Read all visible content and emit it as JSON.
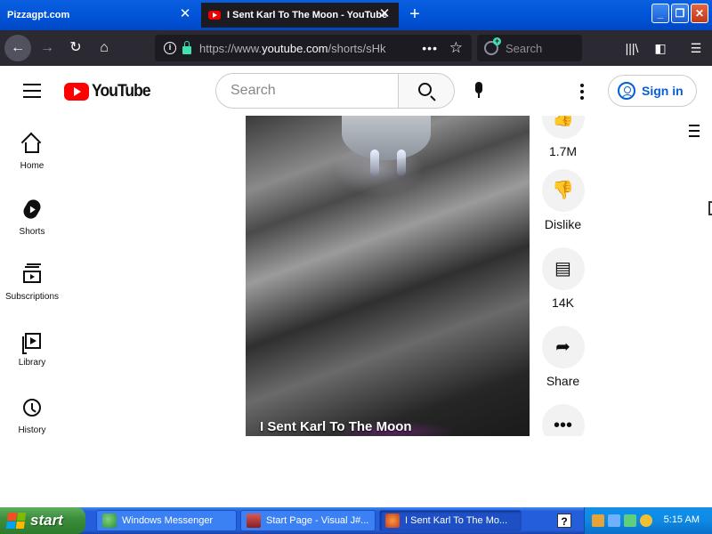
{
  "browser": {
    "tabs": [
      {
        "title": "Pizzagpt.com",
        "active": false
      },
      {
        "title": "I Sent Karl To The Moon - YouTube",
        "active": true
      }
    ],
    "url": {
      "prefix": "https://www.",
      "domain": "youtube.com",
      "rest": "/shorts/sHk"
    },
    "search_placeholder": "Search",
    "accent_color": "#0052d6"
  },
  "youtube": {
    "logo_text": "YouTube",
    "search_placeholder": "Search",
    "signin_label": "Sign in",
    "sidebar": [
      {
        "label": "Home",
        "icon": "home-icon"
      },
      {
        "label": "Shorts",
        "icon": "shorts-icon"
      },
      {
        "label": "Subscriptions",
        "icon": "subscriptions-icon"
      },
      {
        "label": "Library",
        "icon": "library-icon"
      },
      {
        "label": "History",
        "icon": "history-icon"
      }
    ],
    "video": {
      "title": "I Sent Karl To The Moon"
    },
    "actions": {
      "likes": "1.7M",
      "dislike": "Dislike",
      "comments": "14K",
      "share": "Share"
    },
    "brand_color": "#ff0000",
    "link_color": "#065fd4"
  },
  "taskbar": {
    "start_label": "start",
    "tasks": [
      {
        "label": "Windows Messenger",
        "active": false
      },
      {
        "label": "Start Page - Visual J#...",
        "active": false
      },
      {
        "label": "I Sent Karl To The Mo...",
        "active": true
      }
    ],
    "help_label": "?",
    "clock": "5:15 AM"
  }
}
